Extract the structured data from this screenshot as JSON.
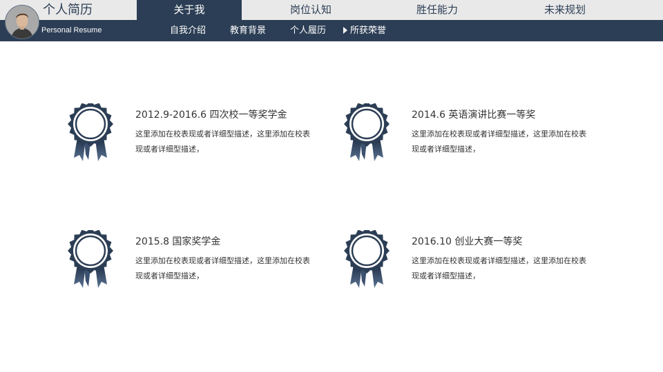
{
  "header": {
    "title": "个人简历",
    "subtitle": "Personal Resume",
    "main_tabs": [
      {
        "label": "关于我"
      },
      {
        "label": "岗位认知"
      },
      {
        "label": "胜任能力"
      },
      {
        "label": "未来规划"
      }
    ],
    "sub_tabs": [
      {
        "label": "自我介绍"
      },
      {
        "label": "教育背景"
      },
      {
        "label": "个人履历"
      },
      {
        "label": "所获荣誉"
      }
    ]
  },
  "awards": [
    {
      "title": "2012.9-2016.6 四次校一等奖学金",
      "desc": "这里添加在校表现或者详细型描述，这里添加在校表现或者详细型描述，"
    },
    {
      "title": "2014.6 英语演讲比赛一等奖",
      "desc": "这里添加在校表现或者详细型描述，这里添加在校表现或者详细型描述，"
    },
    {
      "title": "2015.8 国家奖学金",
      "desc": "这里添加在校表现或者详细型描述，这里添加在校表现或者详细型描述，"
    },
    {
      "title": "2016.10 创业大赛一等奖",
      "desc": "这里添加在校表现或者详细型描述，这里添加在校表现或者详细型描述，"
    }
  ],
  "colors": {
    "accent": "#2c3e55",
    "tab_bg": "#e9e9e9",
    "text": "#333333"
  },
  "icons": {
    "avatar": "person-avatar",
    "medal": "award-medal-icon",
    "arrow": "triangle-right-icon"
  }
}
